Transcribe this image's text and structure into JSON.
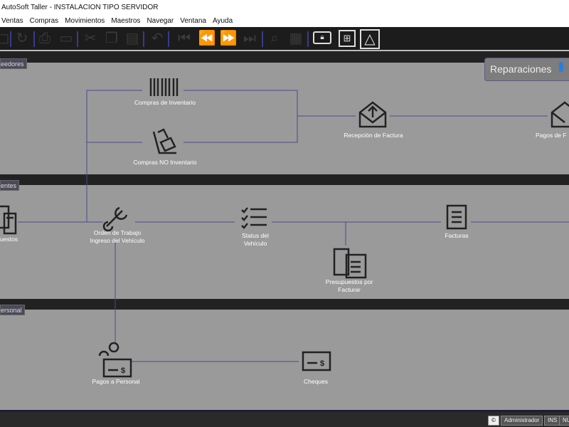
{
  "window": {
    "title": "AutoSoft Taller - INSTALACION TIPO SERVIDOR"
  },
  "menu": [
    "Ventas",
    "Compras",
    "Movimientos",
    "Maestros",
    "Navegar",
    "Ventana",
    "Ayuda"
  ],
  "sections": [
    "eedores",
    "entes",
    "ersonal"
  ],
  "mode_selector": {
    "label": "Reparaciones"
  },
  "nodes": {
    "compras_inventario": "Compras de Inventario",
    "compras_no_inventario": "Compras NO Inventario",
    "recepcion_factura": "Recepción de Factura",
    "pagos_factura": "Pagos de F",
    "presupuestos": "uestos",
    "orden_trabajo": "Orden de Trabajo\nIngreso del Vehículo",
    "status_vehiculo": "Status del\nVehículo",
    "facturas": "Facturas",
    "presupuestos_facturar": "Presupuestos por\nFacturar",
    "pagos_personal": "Pagos a Personal",
    "cheques": "Cheques"
  },
  "status": {
    "user": "Administrador",
    "ins": "INS",
    "num": "NUM"
  },
  "colors": {
    "canvas": "#9a9a9a",
    "flow_line": "#4a4a8a",
    "band": "#222222"
  }
}
